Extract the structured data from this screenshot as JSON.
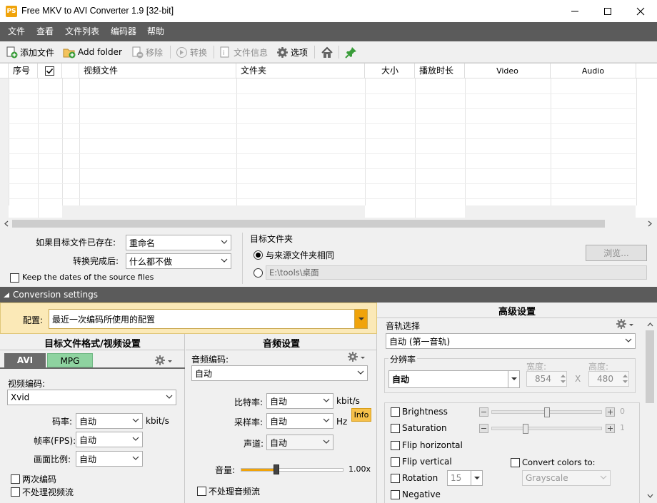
{
  "window": {
    "title": "Free MKV to AVI Converter 1.9  [32-bit]",
    "icon_text": "PS"
  },
  "menu": [
    "文件",
    "查看",
    "文件列表",
    "编码器",
    "帮助"
  ],
  "toolbar": {
    "add_file": "添加文件",
    "add_folder": "Add folder",
    "remove": "移除",
    "convert": "转换",
    "file_info": "文件信息",
    "options": "选项"
  },
  "table": {
    "columns": [
      "序号",
      "",
      "视频文件",
      "文件夹",
      "大小",
      "播放时长",
      "Video",
      "Audio"
    ]
  },
  "options": {
    "if_exists_label": "如果目标文件已存在:",
    "if_exists_value": "重命名",
    "after_convert_label": "转换完成后:",
    "after_convert_value": "什么都不做",
    "keep_dates": "Keep the dates of the source files",
    "target_folder_label": "目标文件夹",
    "same_as_source": "与来源文件夹相同",
    "custom_path": "E:\\tools\\桌面",
    "browse": "浏览..."
  },
  "conversion": {
    "bar_title": "Conversion settings",
    "profile_label": "配置:",
    "profile_value": "最近一次编码所使用的配置"
  },
  "video": {
    "title": "目标文件格式/视频设置",
    "tab_avi": "AVI",
    "tab_mpg": "MPG",
    "codec_label": "视频编码:",
    "codec_value": "Xvid",
    "bitrate_label": "码率:",
    "bitrate_value": "自动",
    "bitrate_unit": "kbit/s",
    "fps_label": "帧率(FPS):",
    "fps_value": "自动",
    "aspect_label": "画面比例:",
    "aspect_value": "自动",
    "two_pass": "两次编码",
    "no_video": "不处理视频流"
  },
  "audio": {
    "title": "音频设置",
    "codec_label": "音频编码:",
    "codec_value": "自动",
    "bitrate_label": "比特率:",
    "bitrate_value": "自动",
    "bitrate_unit": "kbit/s",
    "samplerate_label": "采样率:",
    "samplerate_value": "自动",
    "samplerate_unit": "Hz",
    "info": "Info",
    "channels_label": "声道:",
    "channels_value": "自动",
    "volume_label": "音量:",
    "volume_value": "1.00x",
    "volume_level": 0.35,
    "no_audio": "不处理音频流"
  },
  "advanced": {
    "title": "高级设置",
    "track_label": "音轨选择",
    "track_value": "自动 (第一音轨)",
    "resolution_label": "分辨率",
    "resolution_value": "自动",
    "width_label": "宽度:",
    "width_value": "854",
    "height_label": "高度:",
    "height_value": "480",
    "x_sep": "X",
    "brightness": "Brightness",
    "brightness_value": "0",
    "brightness_level": 0.5,
    "saturation": "Saturation",
    "saturation_value": "1",
    "saturation_level": 0.31,
    "flip_h": "Flip horizontal",
    "flip_v": "Flip vertical",
    "convert_colors": "Convert colors to:",
    "colors_value": "Grayscale",
    "rotation": "Rotation",
    "rotation_value": "15",
    "negative": "Negative"
  },
  "colors": {
    "accent_orange": "#f0a30a",
    "dark_bar": "#5b5b5b",
    "tab_active": "#6b6b6b",
    "tab_mpg": "#8ed3a0",
    "profile_bg": "#fbe9b7"
  }
}
